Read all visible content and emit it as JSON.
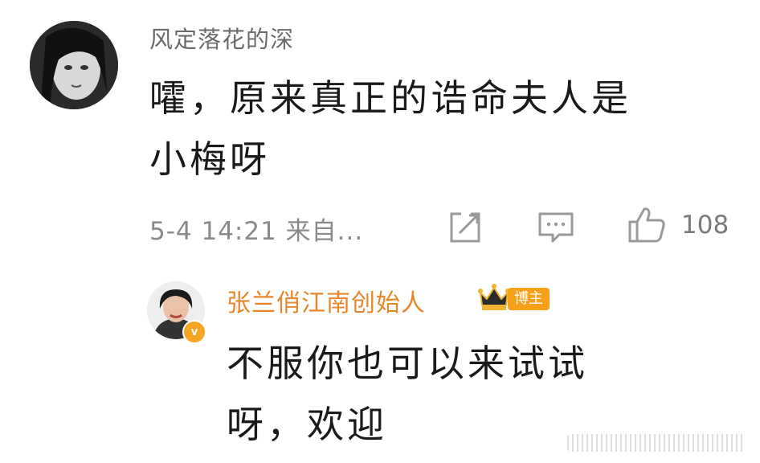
{
  "comment": {
    "username": "风定落花的深",
    "text_line1": "嚯，原来真正的诰命夫人是",
    "text_line2": "小梅呀",
    "meta": "5-4 14:21  来自...",
    "like_count": "108",
    "icons": [
      "share-icon",
      "comment-icon",
      "like-icon"
    ]
  },
  "reply": {
    "username": "张兰俏江南创始人",
    "verified_mark": "v",
    "author_tag": "博主",
    "text_line1": "不服你也可以来试试",
    "text_line2": "呀，欢迎",
    "icons": [
      "crown-icon",
      "verified-icon"
    ]
  },
  "colors": {
    "reply_username": "#e8872a",
    "author_tag_bg": "#f7a11a",
    "verified_badge": "#f6a623",
    "meta_text": "#8a8a8a",
    "body_text": "#1a1a1a"
  }
}
